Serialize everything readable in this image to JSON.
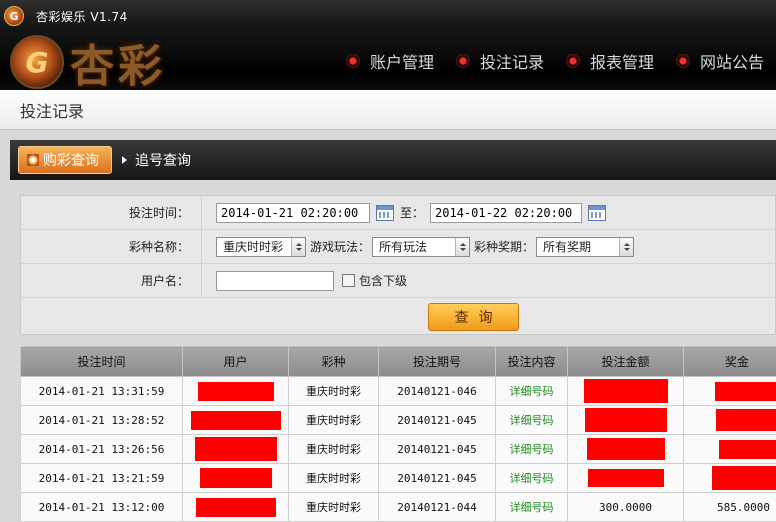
{
  "window": {
    "title": "杏彩娱乐 V1.74",
    "logo_text": "G"
  },
  "brand": {
    "emblem_text": "G",
    "name": "杏彩"
  },
  "nav": [
    {
      "label": "账户管理"
    },
    {
      "label": "投注记录"
    },
    {
      "label": "报表管理"
    },
    {
      "label": "网站公告"
    }
  ],
  "page": {
    "title": "投注记录"
  },
  "tabs": {
    "active": "购彩查询",
    "inactive": "追号查询"
  },
  "form": {
    "time_label": "投注时间：",
    "start_time": "2014-01-21 02:20:00",
    "to_label": "至：",
    "end_time": "2014-01-22 02:20:00",
    "lottery_label": "彩种名称：",
    "lottery_value": "重庆时时彩",
    "play_label": "游戏玩法：",
    "play_value": "所有玩法",
    "issue_label": "彩种奖期：",
    "issue_value": "所有奖期",
    "user_label": "用户名：",
    "user_value": "",
    "include_sub_label": "包含下级",
    "query_button": "查询"
  },
  "table": {
    "headers": [
      "投注时间",
      "用户",
      "彩种",
      "投注期号",
      "投注内容",
      "投注金额",
      "奖金"
    ],
    "rows": [
      {
        "time": "2014-01-21 13:31:59",
        "lottery": "重庆时时彩",
        "issue": "20140121-046",
        "content": "详细号码",
        "amount": "",
        "prize": ""
      },
      {
        "time": "2014-01-21 13:28:52",
        "lottery": "重庆时时彩",
        "issue": "20140121-045",
        "content": "详细号码",
        "amount": "",
        "prize": ""
      },
      {
        "time": "2014-01-21 13:26:56",
        "lottery": "重庆时时彩",
        "issue": "20140121-045",
        "content": "详细号码",
        "amount": "",
        "prize": ""
      },
      {
        "time": "2014-01-21 13:21:59",
        "lottery": "重庆时时彩",
        "issue": "20140121-045",
        "content": "详细号码",
        "amount": "",
        "prize": ""
      },
      {
        "time": "2014-01-21 13:12:00",
        "lottery": "重庆时时彩",
        "issue": "20140121-044",
        "content": "详细号码",
        "amount": "300.0000",
        "prize": "585.0000"
      }
    ]
  },
  "colors": {
    "accent": "#f19a18",
    "link": "#1f8a1f",
    "redaction": "#ff0000"
  }
}
